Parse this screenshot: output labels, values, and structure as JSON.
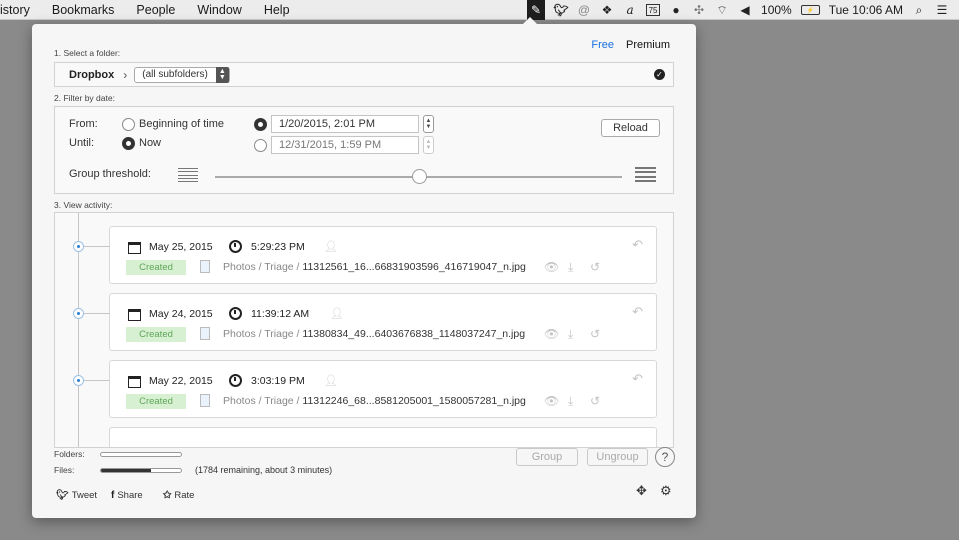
{
  "menubar": {
    "items": [
      "istory",
      "Bookmarks",
      "People",
      "Window",
      "Help"
    ],
    "tray": {
      "icons": [
        "feather-icon",
        "twitter-icon",
        "at-sign-icon",
        "dropbox-icon",
        "script-a-icon",
        "ps-icon",
        "badge-icon",
        "sync-icon",
        "wifi-icon",
        "volume-icon"
      ],
      "battery": "100%",
      "clock": "Tue 10:06 AM"
    }
  },
  "popover": {
    "plan": {
      "free": "Free",
      "premium": "Premium"
    },
    "step1": {
      "label": "1. Select a folder:",
      "folder": "Dropbox",
      "subfolder": "(all subfolders)"
    },
    "step2": {
      "label": "2. Filter by date:",
      "from_label": "From:",
      "until_label": "Until:",
      "beginning_option": "Beginning of time",
      "now_option": "Now",
      "from_date": "1/20/2015,   2:01 PM",
      "until_date": "12/31/2015,   1:59 PM",
      "reload": "Reload",
      "group_threshold": "Group threshold:",
      "threshold_level": 0.5
    },
    "step3": {
      "label": "3. View activity:",
      "items": [
        {
          "date": "May 25, 2015",
          "time": "5:29:23 PM",
          "status": "Created",
          "folder": "Photos / Triage / ",
          "file": "11312561_16...66831903596_416719047_n.jpg"
        },
        {
          "date": "May 24, 2015",
          "time": "11:39:12 AM",
          "status": "Created",
          "folder": "Photos / Triage / ",
          "file": "11380834_49...6403676838_1148037247_n.jpg"
        },
        {
          "date": "May 22, 2015",
          "time": "3:03:19 PM",
          "status": "Created",
          "folder": "Photos / Triage / ",
          "file": "11312246_68...8581205001_1580057281_n.jpg"
        }
      ]
    },
    "progress": {
      "folders_label": "Folders:",
      "files_label": "Files:",
      "folders_progress": 0.0,
      "files_progress": 0.62,
      "files_note": "(1784 remaining, about 3 minutes)"
    },
    "buttons": {
      "group": "Group",
      "ungroup": "Ungroup",
      "help": "?"
    },
    "social": {
      "tweet": "Tweet",
      "share": "Share",
      "rate": "Rate"
    }
  }
}
